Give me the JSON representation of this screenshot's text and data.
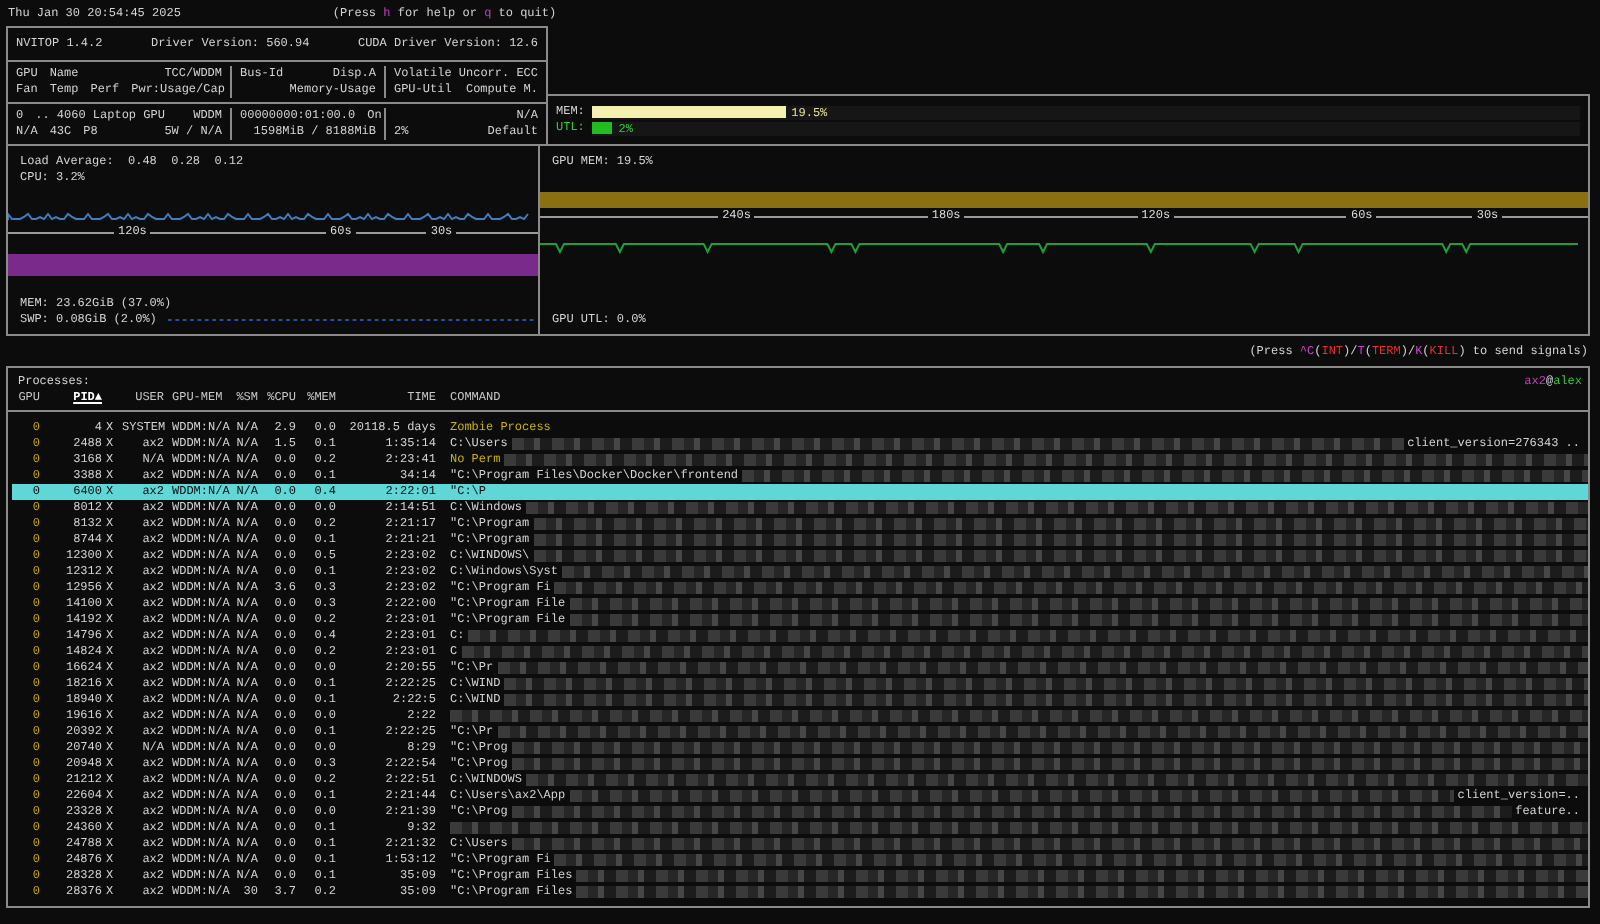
{
  "clock": "Thu Jan 30 20:54:45 2025",
  "help_hint": {
    "before": "(Press ",
    "key1": "h",
    "middle": " for help or ",
    "key2": "q",
    "after": " to quit)"
  },
  "gpu_panel": {
    "title": "NVITOP 1.4.2",
    "driver": "Driver Version: 560.94",
    "cuda": "CUDA Driver Version: 12.6",
    "header": [
      {
        "lines": [
          [
            "GPU",
            "Name",
            "TCC/WDDM"
          ],
          [
            "Fan",
            "Temp",
            "Perf",
            "Pwr:Usage/Cap"
          ]
        ]
      },
      {
        "lines": [
          [
            "Bus-Id",
            "Disp.A"
          ],
          [
            "Memory-Usage"
          ]
        ]
      },
      {
        "lines": [
          [
            "Volatile Uncorr. ECC"
          ],
          [
            "GPU-Util",
            "Compute M."
          ]
        ]
      }
    ],
    "devices": [
      {
        "sections": [
          {
            "lines": [
              [
                "0",
                ".. 4060 Laptop GPU",
                "WDDM"
              ],
              [
                "N/A",
                "43C",
                "P8",
                "5W / N/A"
              ]
            ]
          },
          {
            "lines": [
              [
                "00000000:01:00.0",
                "On"
              ],
              [
                "1598MiB / 8188MiB"
              ]
            ]
          },
          {
            "lines": [
              [
                "N/A"
              ],
              [
                "2%",
                "Default"
              ]
            ]
          }
        ],
        "bars": [
          {
            "label": "MEM:",
            "level": 0.195,
            "reading": "19.5%",
            "kind": "memory"
          },
          {
            "label": "UTL:",
            "level": 0.02,
            "reading": "2%",
            "kind": "utilization"
          }
        ]
      }
    ]
  },
  "host_panel": {
    "load": "Load Average:  0.48  0.28  0.12",
    "cpu": "CPU: 3.2%",
    "cpu_axis": [
      "120s",
      "60s",
      "30s"
    ],
    "mem": "MEM: 23.62GiB (37.0%)",
    "swap": "SWP: 0.08GiB (2.0%)",
    "gpu_mem": "GPU MEM: 19.5%",
    "gpu_axis": [
      "240s",
      "180s",
      "120s",
      "60s",
      "30s"
    ],
    "gpu_util": "GPU UTL: 0.0%"
  },
  "signal_hint": [
    {
      "text": "(Press ",
      "kind": "plain"
    },
    {
      "text": "^C",
      "kind": "key"
    },
    {
      "text": "(",
      "kind": "plain"
    },
    {
      "text": "INT",
      "kind": "signal"
    },
    {
      "text": ")/",
      "kind": "plain"
    },
    {
      "text": "T",
      "kind": "key"
    },
    {
      "text": "(",
      "kind": "plain"
    },
    {
      "text": "TERM",
      "kind": "signal"
    },
    {
      "text": ")/",
      "kind": "plain"
    },
    {
      "text": "K",
      "kind": "key"
    },
    {
      "text": "(",
      "kind": "plain"
    },
    {
      "text": "KILL",
      "kind": "signal"
    },
    {
      "text": ") to send signals)",
      "kind": "plain"
    }
  ],
  "processes": {
    "title": "Processes:",
    "user": "ax2",
    "at": "@",
    "host": "alex",
    "columns": [
      {
        "label": "GPU",
        "sorted": false
      },
      {
        "label": "PID▲",
        "sorted": true
      },
      {
        "label": "USER",
        "sorted": false
      },
      {
        "label": "GPU-MEM",
        "sorted": false
      },
      {
        "label": "%SM",
        "sorted": false
      },
      {
        "label": "%CPU",
        "sorted": false
      },
      {
        "label": "%MEM",
        "sorted": false
      },
      {
        "label": "TIME",
        "sorted": false
      },
      {
        "label": "COMMAND",
        "sorted": false
      }
    ],
    "rows": [
      {
        "gpu": "0",
        "pid": "4",
        "type": "X",
        "user": "SYSTEM",
        "gpu_mem": "WDDM:N/A",
        "sm": "N/A",
        "cpu": "2.9",
        "mem": "0.0",
        "time": "20118.5 days",
        "command": "Zombie Process",
        "kind": "zombie",
        "selected": false
      },
      {
        "gpu": "0",
        "pid": "2488",
        "type": "X",
        "user": "ax2",
        "gpu_mem": "WDDM:N/A",
        "sm": "N/A",
        "cpu": "1.5",
        "mem": "0.1",
        "time": "1:35:14",
        "command": "C:\\Users",
        "tail": "client_version=276343 ..",
        "kind": "normal",
        "selected": false
      },
      {
        "gpu": "0",
        "pid": "3168",
        "type": "X",
        "user": "N/A",
        "gpu_mem": "WDDM:N/A",
        "sm": "N/A",
        "cpu": "0.0",
        "mem": "0.2",
        "time": "2:23:41",
        "command": "No Perm",
        "kind": "no-permission",
        "selected": false
      },
      {
        "gpu": "0",
        "pid": "3388",
        "type": "X",
        "user": "ax2",
        "gpu_mem": "WDDM:N/A",
        "sm": "N/A",
        "cpu": "0.0",
        "mem": "0.1",
        "time": "34:14",
        "command": "\"C:\\Program Files\\Docker\\Docker\\frontend",
        "kind": "normal",
        "selected": false
      },
      {
        "gpu": "0",
        "pid": "6400",
        "type": "X",
        "user": "ax2",
        "gpu_mem": "WDDM:N/A",
        "sm": "N/A",
        "cpu": "0.0",
        "mem": "0.4",
        "time": "2:22:01",
        "command": "\"C:\\P",
        "kind": "normal",
        "selected": true
      },
      {
        "gpu": "0",
        "pid": "8012",
        "type": "X",
        "user": "ax2",
        "gpu_mem": "WDDM:N/A",
        "sm": "N/A",
        "cpu": "0.0",
        "mem": "0.0",
        "time": "2:14:51",
        "command": "C:\\Windows",
        "kind": "normal",
        "selected": false
      },
      {
        "gpu": "0",
        "pid": "8132",
        "type": "X",
        "user": "ax2",
        "gpu_mem": "WDDM:N/A",
        "sm": "N/A",
        "cpu": "0.0",
        "mem": "0.2",
        "time": "2:21:17",
        "command": "\"C:\\Program",
        "kind": "normal",
        "selected": false
      },
      {
        "gpu": "0",
        "pid": "8744",
        "type": "X",
        "user": "ax2",
        "gpu_mem": "WDDM:N/A",
        "sm": "N/A",
        "cpu": "0.0",
        "mem": "0.1",
        "time": "2:21:21",
        "command": "\"C:\\Program",
        "kind": "normal",
        "selected": false
      },
      {
        "gpu": "0",
        "pid": "12300",
        "type": "X",
        "user": "ax2",
        "gpu_mem": "WDDM:N/A",
        "sm": "N/A",
        "cpu": "0.0",
        "mem": "0.5",
        "time": "2:23:02",
        "command": "C:\\WINDOWS\\",
        "kind": "normal",
        "selected": false
      },
      {
        "gpu": "0",
        "pid": "12312",
        "type": "X",
        "user": "ax2",
        "gpu_mem": "WDDM:N/A",
        "sm": "N/A",
        "cpu": "0.0",
        "mem": "0.1",
        "time": "2:23:02",
        "command": "C:\\Windows\\Syst",
        "kind": "normal",
        "selected": false
      },
      {
        "gpu": "0",
        "pid": "12956",
        "type": "X",
        "user": "ax2",
        "gpu_mem": "WDDM:N/A",
        "sm": "N/A",
        "cpu": "3.6",
        "mem": "0.3",
        "time": "2:23:02",
        "command": "\"C:\\Program Fi",
        "kind": "normal",
        "selected": false
      },
      {
        "gpu": "0",
        "pid": "14100",
        "type": "X",
        "user": "ax2",
        "gpu_mem": "WDDM:N/A",
        "sm": "N/A",
        "cpu": "0.0",
        "mem": "0.3",
        "time": "2:22:00",
        "command": "\"C:\\Program File",
        "kind": "normal",
        "selected": false
      },
      {
        "gpu": "0",
        "pid": "14192",
        "type": "X",
        "user": "ax2",
        "gpu_mem": "WDDM:N/A",
        "sm": "N/A",
        "cpu": "0.0",
        "mem": "0.2",
        "time": "2:23:01",
        "command": "\"C:\\Program File",
        "kind": "normal",
        "selected": false
      },
      {
        "gpu": "0",
        "pid": "14796",
        "type": "X",
        "user": "ax2",
        "gpu_mem": "WDDM:N/A",
        "sm": "N/A",
        "cpu": "0.0",
        "mem": "0.4",
        "time": "2:23:01",
        "command": "C:",
        "kind": "normal",
        "selected": false
      },
      {
        "gpu": "0",
        "pid": "14824",
        "type": "X",
        "user": "ax2",
        "gpu_mem": "WDDM:N/A",
        "sm": "N/A",
        "cpu": "0.0",
        "mem": "0.2",
        "time": "2:23:01",
        "command": "C",
        "kind": "normal",
        "selected": false
      },
      {
        "gpu": "0",
        "pid": "16624",
        "type": "X",
        "user": "ax2",
        "gpu_mem": "WDDM:N/A",
        "sm": "N/A",
        "cpu": "0.0",
        "mem": "0.0",
        "time": "2:20:55",
        "command": "\"C:\\Pr",
        "kind": "normal",
        "selected": false
      },
      {
        "gpu": "0",
        "pid": "18216",
        "type": "X",
        "user": "ax2",
        "gpu_mem": "WDDM:N/A",
        "sm": "N/A",
        "cpu": "0.0",
        "mem": "0.1",
        "time": "2:22:25",
        "command": "C:\\WIND",
        "kind": "normal",
        "selected": false
      },
      {
        "gpu": "0",
        "pid": "18940",
        "type": "X",
        "user": "ax2",
        "gpu_mem": "WDDM:N/A",
        "sm": "N/A",
        "cpu": "0.0",
        "mem": "0.1",
        "time": "2:22:5",
        "command": "C:\\WIND",
        "kind": "normal",
        "selected": false
      },
      {
        "gpu": "0",
        "pid": "19616",
        "type": "X",
        "user": "ax2",
        "gpu_mem": "WDDM:N/A",
        "sm": "N/A",
        "cpu": "0.0",
        "mem": "0.0",
        "time": "2:22",
        "kind": "normal",
        "selected": false
      },
      {
        "gpu": "0",
        "pid": "20392",
        "type": "X",
        "user": "ax2",
        "gpu_mem": "WDDM:N/A",
        "sm": "N/A",
        "cpu": "0.0",
        "mem": "0.1",
        "time": "2:22:25",
        "command": "\"C:\\Pr",
        "kind": "normal",
        "selected": false
      },
      {
        "gpu": "0",
        "pid": "20740",
        "type": "X",
        "user": "N/A",
        "gpu_mem": "WDDM:N/A",
        "sm": "N/A",
        "cpu": "0.0",
        "mem": "0.0",
        "time": "8:29",
        "command": "\"C:\\Prog",
        "kind": "normal",
        "selected": false
      },
      {
        "gpu": "0",
        "pid": "20948",
        "type": "X",
        "user": "ax2",
        "gpu_mem": "WDDM:N/A",
        "sm": "N/A",
        "cpu": "0.0",
        "mem": "0.3",
        "time": "2:22:54",
        "command": "\"C:\\Prog",
        "kind": "normal",
        "selected": false
      },
      {
        "gpu": "0",
        "pid": "21212",
        "type": "X",
        "user": "ax2",
        "gpu_mem": "WDDM:N/A",
        "sm": "N/A",
        "cpu": "0.0",
        "mem": "0.2",
        "time": "2:22:51",
        "command": "C:\\WINDOWS",
        "kind": "normal",
        "selected": false
      },
      {
        "gpu": "0",
        "pid": "22604",
        "type": "X",
        "user": "ax2",
        "gpu_mem": "WDDM:N/A",
        "sm": "N/A",
        "cpu": "0.0",
        "mem": "0.1",
        "time": "2:21:44",
        "command": "C:\\Users\\ax2\\App",
        "tail": "client_version=..",
        "kind": "normal",
        "selected": false
      },
      {
        "gpu": "0",
        "pid": "23328",
        "type": "X",
        "user": "ax2",
        "gpu_mem": "WDDM:N/A",
        "sm": "N/A",
        "cpu": "0.0",
        "mem": "0.0",
        "time": "2:21:39",
        "command": "\"C:\\Prog",
        "tail": "feature..",
        "kind": "normal",
        "selected": false
      },
      {
        "gpu": "0",
        "pid": "24360",
        "type": "X",
        "user": "ax2",
        "gpu_mem": "WDDM:N/A",
        "sm": "N/A",
        "cpu": "0.0",
        "mem": "0.1",
        "time": "9:32",
        "kind": "normal",
        "selected": false
      },
      {
        "gpu": "0",
        "pid": "24788",
        "type": "X",
        "user": "ax2",
        "gpu_mem": "WDDM:N/A",
        "sm": "N/A",
        "cpu": "0.0",
        "mem": "0.1",
        "time": "2:21:32",
        "command": "C:\\Users",
        "kind": "normal",
        "selected": false
      },
      {
        "gpu": "0",
        "pid": "24876",
        "type": "X",
        "user": "ax2",
        "gpu_mem": "WDDM:N/A",
        "sm": "N/A",
        "cpu": "0.0",
        "mem": "0.1",
        "time": "1:53:12",
        "command": "\"C:\\Program Fi",
        "kind": "normal",
        "selected": false
      },
      {
        "gpu": "0",
        "pid": "28328",
        "type": "X",
        "user": "ax2",
        "gpu_mem": "WDDM:N/A",
        "sm": "N/A",
        "cpu": "0.0",
        "mem": "0.1",
        "time": "35:09",
        "command": "\"C:\\Program Files",
        "kind": "normal",
        "selected": false
      },
      {
        "gpu": "0",
        "pid": "28376",
        "type": "X",
        "user": "ax2",
        "gpu_mem": "WDDM:N/A",
        "sm": "30",
        "cpu": "3.7",
        "mem": "0.2",
        "time": "35:09",
        "command": "\"C:\\Program Files",
        "kind": "normal",
        "selected": false
      }
    ]
  }
}
